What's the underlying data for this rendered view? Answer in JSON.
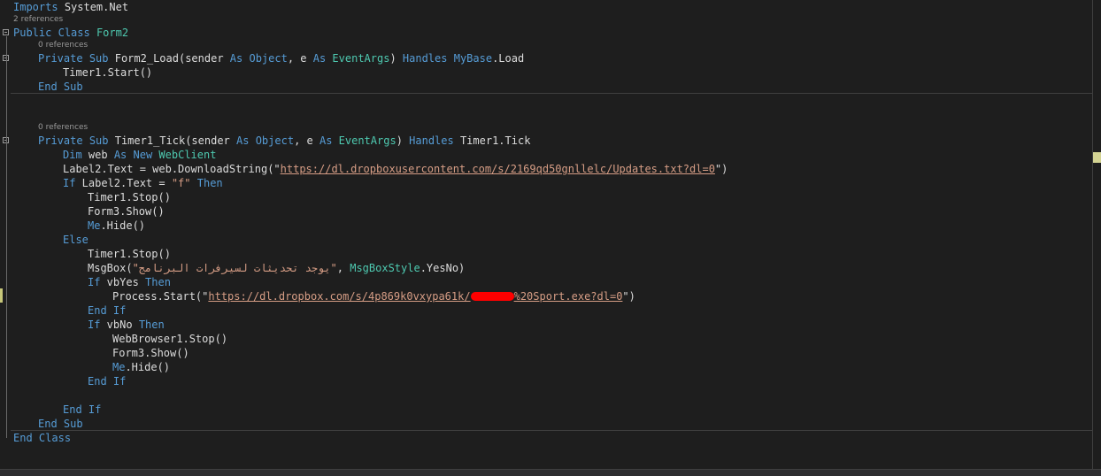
{
  "editor": {
    "language": "VB.NET",
    "codelens": {
      "two_refs": "2 references",
      "zero_refs_a": "0 references",
      "zero_refs_b": "0 references"
    },
    "lines": {
      "l01": "System.Net",
      "l01_kw": "Imports",
      "l02_a": "Public",
      "l02_b": "Class",
      "l02_c": "Form2",
      "l03_a": "Private",
      "l03_b": "Sub",
      "l03_c": "Form2_Load(sender ",
      "l03_d": "As",
      "l03_e": "Object",
      "l03_f": ", e ",
      "l03_g": "As",
      "l03_h": "EventArgs",
      "l03_i": ") ",
      "l03_j": "Handles",
      "l03_k": "MyBase",
      "l03_l": ".Load",
      "l04": "Timer1.Start()",
      "l05_a": "End",
      "l05_b": "Sub",
      "l06_a": "Private",
      "l06_b": "Sub",
      "l06_c": "Timer1_Tick(sender ",
      "l06_d": "As",
      "l06_e": "Object",
      "l06_f": ", e ",
      "l06_g": "As",
      "l06_h": "EventArgs",
      "l06_i": ") ",
      "l06_j": "Handles",
      "l06_k": " Timer1.Tick",
      "l07_a": "Dim",
      "l07_b": " web ",
      "l07_c": "As",
      "l07_d": "New",
      "l07_e": "WebClient",
      "l08_a": "Label2.Text = web.DownloadString(\"",
      "l08_url": "https://dl.dropboxusercontent.com/s/2169qd50gnllelc/Updates.txt?dl=0",
      "l08_b": "\")",
      "l09_a": "If",
      "l09_b": " Label2.Text = ",
      "l09_c": "\"f\"",
      "l09_d": "Then",
      "l10": "Timer1.Stop()",
      "l11": "Form3.Show()",
      "l12_a": "Me",
      "l12_b": ".Hide()",
      "l13": "Else",
      "l14": "Timer1.Stop()",
      "l15_a": "MsgBox(",
      "l15_str": "\"يوجد تحديثات لسيرفرات البرنامج\"",
      "l15_b": ", ",
      "l15_c": "MsgBoxStyle",
      "l15_d": ".YesNo)",
      "l16_a": "If",
      "l16_b": " vbYes ",
      "l16_c": "Then",
      "l17_a": "Process.Start(\"",
      "l17_url_a": "https://dl.dropbox.com/s/4p869k0vxypa61k/",
      "l17_url_b": "%20Sport.exe?dl=0",
      "l17_b": "\")",
      "l18_a": "End",
      "l18_b": "If",
      "l19_a": "If",
      "l19_b": " vbNo ",
      "l19_c": "Then",
      "l20": "WebBrowser1.Stop()",
      "l21": "Form3.Show()",
      "l22_a": "Me",
      "l22_b": ".Hide()",
      "l23_a": "End",
      "l23_b": "If",
      "l24_a": "End",
      "l24_b": "If",
      "l25_a": "End",
      "l25_b": "Sub",
      "l26_a": "End",
      "l26_b": "Class"
    }
  },
  "colors": {
    "background": "#1e1e1e",
    "keyword": "#569cd6",
    "type": "#4ec9b0",
    "string": "#d69d85",
    "text": "#dcdcdc",
    "codelens": "#999999",
    "redaction": "#ff0000"
  },
  "icons": {
    "fold": "collapse-box-icon"
  }
}
